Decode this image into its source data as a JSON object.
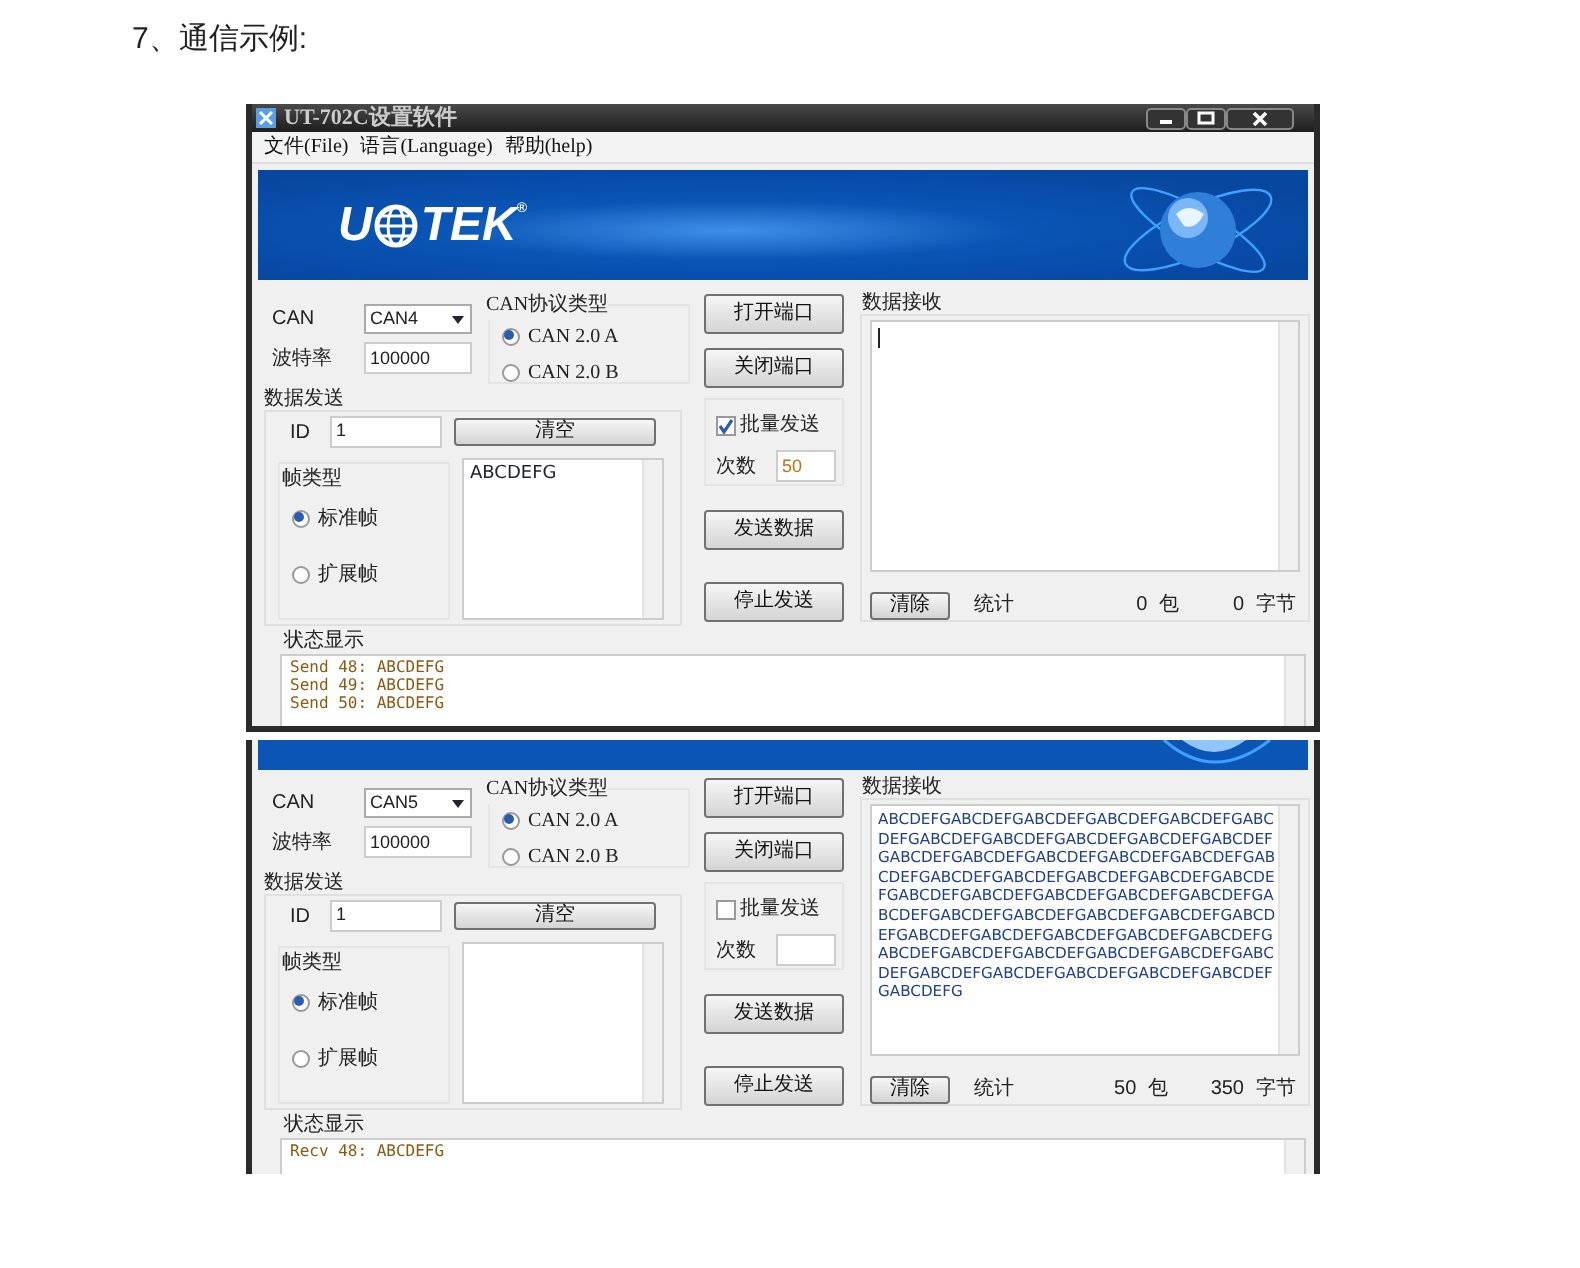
{
  "heading": "7、通信示例:",
  "windows": [
    {
      "title_bar": {
        "title": "UT-702C设置软件"
      },
      "menu": [
        "文件(File)",
        "语言(Language)",
        "帮助(help)"
      ],
      "banner": {
        "kind": "full",
        "logo_left": "U",
        "logo_right": "TEK",
        "logo_mark": "®"
      },
      "can": {
        "label": "CAN",
        "value": "CAN4"
      },
      "baud": {
        "label": "波特率",
        "value": "100000"
      },
      "protocol": {
        "title": "CAN协议类型",
        "options": [
          {
            "label": "CAN 2.0 A",
            "selected": true
          },
          {
            "label": "CAN 2.0 B",
            "selected": false
          }
        ]
      },
      "send": {
        "title": "数据发送",
        "id_label": "ID",
        "id_value": "1",
        "clear_button": "清空",
        "frame_title": "帧类型",
        "frame_options": [
          {
            "label": "标准帧",
            "selected": true
          },
          {
            "label": "扩展帧",
            "selected": false
          }
        ],
        "text": "ABCDEFG"
      },
      "port_buttons": [
        "打开端口",
        "关闭端口"
      ],
      "batch": {
        "label": "批量发送",
        "checked": true,
        "count_label": "次数",
        "count": "50"
      },
      "action_buttons": [
        "发送数据",
        "停止发送"
      ],
      "receive": {
        "title": "数据接收",
        "caret": true,
        "clear_button": "清除",
        "stats_label": "统计",
        "packets": "0",
        "packets_unit": "包",
        "bytes": "0",
        "bytes_unit": "字节"
      },
      "status": {
        "title": "状态显示",
        "lines": [
          "Send 48: ABCDEFG",
          "Send 49: ABCDEFG",
          "Send 50: ABCDEFG"
        ]
      }
    },
    {
      "banner": {
        "kind": "strip"
      },
      "can": {
        "label": "CAN",
        "value": "CAN5"
      },
      "baud": {
        "label": "波特率",
        "value": "100000"
      },
      "protocol": {
        "title": "CAN协议类型",
        "options": [
          {
            "label": "CAN 2.0 A",
            "selected": true
          },
          {
            "label": "CAN 2.0 B",
            "selected": false
          }
        ]
      },
      "send": {
        "title": "数据发送",
        "id_label": "ID",
        "id_value": "1",
        "clear_button": "清空",
        "frame_title": "帧类型",
        "frame_options": [
          {
            "label": "标准帧",
            "selected": true
          },
          {
            "label": "扩展帧",
            "selected": false
          }
        ]
      },
      "port_buttons": [
        "打开端口",
        "关闭端口"
      ],
      "batch": {
        "label": "批量发送",
        "checked": false,
        "count_label": "次数"
      },
      "action_buttons": [
        "发送数据",
        "停止发送"
      ],
      "receive": {
        "title": "数据接收",
        "caret": false,
        "lines": [
          "ABCDEFGABCDEFGABCDEFGABCDEFGABCDEFGABC",
          "DEFGABCDEFGABCDEFGABCDEFGABCDEFGABCDEF",
          "GABCDEFGABCDEFGABCDEFGABCDEFGABCDEFGAB",
          "CDEFGABCDEFGABCDEFGABCDEFGABCDEFGABCDE",
          "FGABCDEFGABCDEFGABCDEFGABCDEFGABCDEFGA",
          "BCDEFGABCDEFGABCDEFGABCDEFGABCDEFGABCD",
          "EFGABCDEFGABCDEFGABCDEFGABCDEFGABCDEFG",
          "ABCDEFGABCDEFGABCDEFGABCDEFGABCDEFGABC",
          "DEFGABCDEFGABCDEFGABCDEFGABCDEFGABCDEF",
          "GABCDEFG"
        ],
        "clear_button": "清除",
        "stats_label": "统计",
        "packets": "50",
        "packets_unit": "包",
        "bytes": "350",
        "bytes_unit": "字节"
      },
      "status": {
        "title": "状态显示",
        "lines": [
          "Recv 48: ABCDEFG"
        ]
      }
    }
  ]
}
